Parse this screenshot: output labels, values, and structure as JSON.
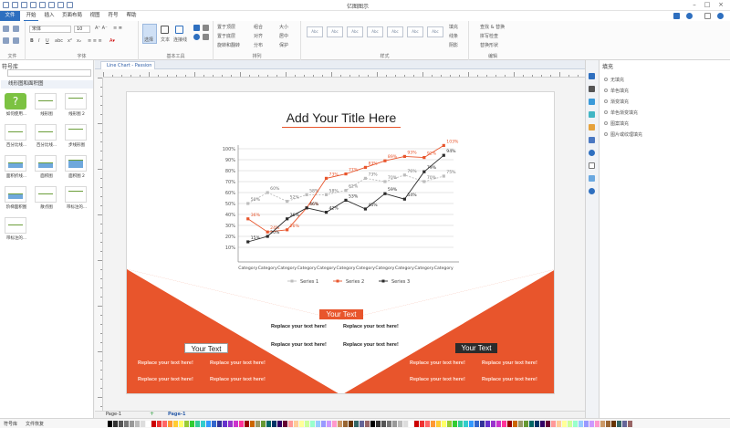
{
  "app": {
    "title": "亿图图示"
  },
  "menu": {
    "tabs": [
      "文件",
      "开始",
      "插入",
      "页面布局",
      "视图",
      "符号",
      "帮助"
    ]
  },
  "ribbon": {
    "font_family": "宋体",
    "font_size": "10",
    "groups": [
      "文件",
      "字体",
      "基本工具",
      "排列",
      "样式",
      "编辑"
    ],
    "tools": [
      "选择",
      "文本",
      "连接线"
    ],
    "arrange": [
      "置于顶层",
      "置于底层",
      "旋转和翻转",
      "组合",
      "对齐",
      "分布",
      "大小",
      "居中",
      "保护"
    ],
    "style_box_label": "Abc",
    "fill_items": [
      "填充",
      "线条",
      "阴影"
    ],
    "edit_items": [
      "查找 & 替换",
      "拼写检查",
      "替换形状"
    ]
  },
  "left_panel": {
    "title": "符号库",
    "section": "线形图和面积图",
    "shapes": [
      {
        "label": "如何使用..."
      },
      {
        "label": "线形图"
      },
      {
        "label": "线形图 2"
      },
      {
        "label": "百分比线..."
      },
      {
        "label": "百分比线..."
      },
      {
        "label": "步线形图"
      },
      {
        "label": "面积折线..."
      },
      {
        "label": "面积图"
      },
      {
        "label": "面积图 2"
      },
      {
        "label": "阶梯面积图"
      },
      {
        "label": "散点图"
      },
      {
        "label": "带标注的..."
      },
      {
        "label": "带标注的..."
      }
    ]
  },
  "doc_tab": "Line Chart - Passion",
  "document": {
    "title": "Add Your Title Here",
    "your_text_center": "Your Text",
    "your_text_left": "Your Text",
    "your_text_right": "Your Text",
    "replace_text": "Replace your text here!",
    "colors": {
      "accent": "#e8552c",
      "dark": "#2b2b2b"
    }
  },
  "chart_data": {
    "type": "line",
    "categories": [
      "Category",
      "Category",
      "Category",
      "Category",
      "Category",
      "Category",
      "Category",
      "Category",
      "Category",
      "Category",
      "Category"
    ],
    "ylim": [
      0,
      100
    ],
    "yticks": [
      "10%",
      "20%",
      "30%",
      "40%",
      "50%",
      "60%",
      "70%",
      "80%",
      "90%",
      "100%"
    ],
    "series": [
      {
        "name": "Series 1",
        "color": "#bdbdbd",
        "values": [
          50,
          60,
          52,
          58,
          58,
          62,
          73,
          70,
          76,
          70,
          75
        ]
      },
      {
        "name": "Series 2",
        "color": "#e8552c",
        "values": [
          36,
          24,
          26,
          46,
          73,
          77,
          83,
          89,
          93,
          92,
          103
        ]
      },
      {
        "name": "Series 3",
        "color": "#2b2b2b",
        "values": [
          15,
          20,
          36,
          46,
          42,
          53,
          45,
          59,
          54,
          79,
          94
        ]
      }
    ],
    "legend": "bottom"
  },
  "right_panel": {
    "title": "填充",
    "options": [
      "无填充",
      "单色填充",
      "渐变填充",
      "单色渐变填充",
      "图案填充",
      "图片或纹理填充"
    ]
  },
  "page_tabs": [
    "Page-1",
    "Page-1"
  ],
  "status": {
    "left1": "符号库",
    "left2": "文件恢复"
  }
}
